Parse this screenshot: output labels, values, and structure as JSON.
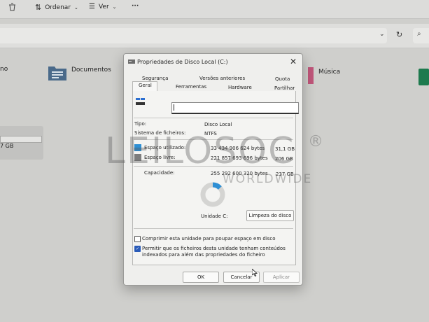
{
  "explorer": {
    "cmdbar": {
      "sort_label": "Ordenar",
      "view_label": "Ver",
      "more_label": "···"
    },
    "folders": {
      "partial_left": "no",
      "documents": "Documentos",
      "music": "Música"
    },
    "drive_size_partial": "7 GB"
  },
  "dialog": {
    "title": "Propriedades de Disco Local (C:)",
    "tabs_top": [
      "Segurança",
      "Versões anteriores",
      "Quota"
    ],
    "tabs_bottom": [
      "Geral",
      "Ferramentas",
      "Hardware",
      "Partilhar"
    ],
    "active_tab": "Geral",
    "name_value": "",
    "type_label": "Tipo:",
    "type_value": "Disco Local",
    "fs_label": "Sistema de ficheiros:",
    "fs_value": "NTFS",
    "used_label": "Espaço utilizado:",
    "used_bytes": "33 434 906 624 bytes",
    "used_gb": "31,1 GB",
    "free_label": "Espaço livre:",
    "free_bytes": "221 857 693 696 bytes",
    "free_gb": "206 GB",
    "capacity_label": "Capacidade:",
    "capacity_bytes": "255 292 600 320 bytes",
    "capacity_gb": "237 GB",
    "used_fraction": 0.131,
    "drive_label": "Unidade C:",
    "cleanup_button": "Limpeza do disco",
    "compress_label": "Comprimir esta unidade para poupar espaço em disco",
    "compress_checked": false,
    "index_label_line1": "Permitir que os ficheiros desta unidade tenham conteúdos",
    "index_label_line2": "indexados para além das propriedades do ficheiro",
    "index_checked": true,
    "ok_button": "OK",
    "cancel_button": "Cancelar",
    "apply_button": "Aplicar"
  },
  "colors": {
    "used": "#2e8fd4",
    "free": "#7d7d7d",
    "accent": "#2a5bb8"
  },
  "watermark": {
    "brand": "LEILOSOC",
    "registered": "®",
    "tagline": "WORLDWIDE"
  }
}
